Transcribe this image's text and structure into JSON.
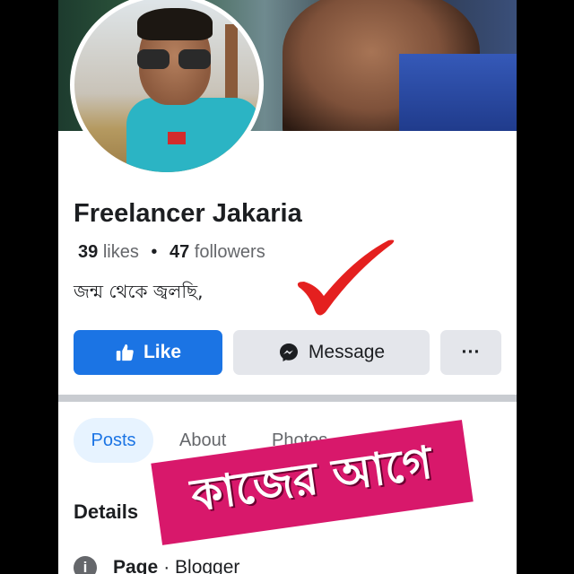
{
  "profile": {
    "name": "Freelancer Jakaria",
    "likes_count": "39",
    "likes_label": "likes",
    "separator": "•",
    "followers_count": "47",
    "followers_label": "followers",
    "bio": "জন্ম থেকে জ্বলছি,"
  },
  "actions": {
    "like_label": "Like",
    "message_label": "Message",
    "more_label": "···"
  },
  "tabs": [
    {
      "label": "Posts",
      "active": true
    },
    {
      "label": "About",
      "active": false
    },
    {
      "label": "Photos",
      "active": false
    }
  ],
  "details": {
    "heading": "Details",
    "page_key": "Page",
    "page_value": "· Blogger"
  },
  "overlay": {
    "banner_text": "কাজের আগে",
    "check_icon": "red-check-mark-icon"
  },
  "colors": {
    "accent": "#1b74e4",
    "banner": "#d8186b",
    "check": "#e4201f"
  }
}
